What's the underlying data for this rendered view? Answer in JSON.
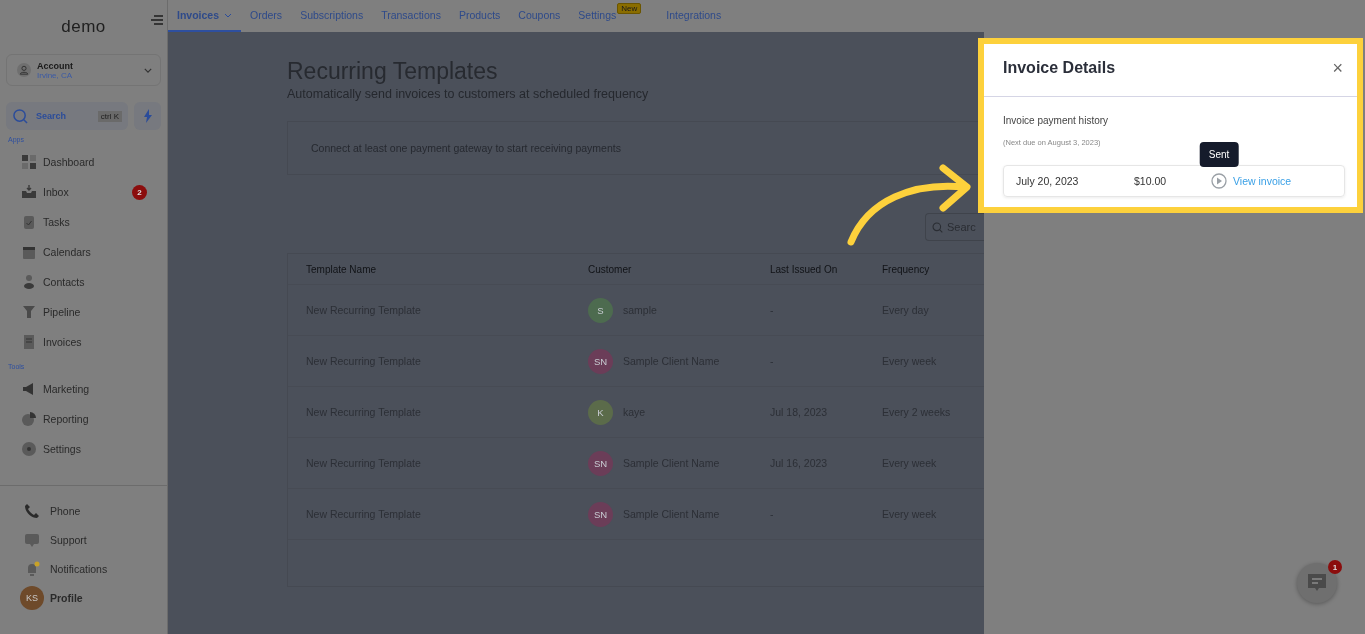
{
  "sidebar": {
    "logo": "demo",
    "account": {
      "name": "Account",
      "location": "Irvine, CA"
    },
    "search": {
      "label": "Search",
      "shortcut": "ctrl K"
    },
    "sections": [
      {
        "title": "Apps",
        "items": [
          {
            "label": "Dashboard"
          },
          {
            "label": "Inbox",
            "badge": "2"
          },
          {
            "label": "Tasks"
          },
          {
            "label": "Calendars"
          },
          {
            "label": "Contacts"
          },
          {
            "label": "Pipeline"
          },
          {
            "label": "Invoices"
          }
        ]
      },
      {
        "title": "Tools",
        "items": [
          {
            "label": "Marketing"
          },
          {
            "label": "Reporting"
          },
          {
            "label": "Settings"
          }
        ]
      }
    ],
    "footer": [
      {
        "label": "Phone"
      },
      {
        "label": "Support"
      },
      {
        "label": "Notifications"
      },
      {
        "label": "Profile",
        "initials": "KS"
      }
    ]
  },
  "tabs": [
    {
      "label": "Invoices",
      "selected": true,
      "dropdown": true
    },
    {
      "label": "Orders",
      "selected": false
    },
    {
      "label": "Subscriptions",
      "selected": false
    },
    {
      "label": "Transactions",
      "selected": false
    },
    {
      "label": "Products",
      "selected": false
    },
    {
      "label": "Coupons",
      "selected": false
    },
    {
      "label": "Settings",
      "selected": false,
      "badge": "New"
    },
    {
      "label": "Integrations",
      "selected": false
    }
  ],
  "page": {
    "title": "Recurring Templates",
    "subtitle": "Automatically send invoices to customers at scheduled frequency",
    "notice": "Connect at least one payment gateway to start receiving payments",
    "search": "Searc"
  },
  "table": {
    "columns": [
      "Template Name",
      "Customer",
      "Last Issued On",
      "Frequency"
    ],
    "rows": [
      {
        "name": "New Recurring Template",
        "initials": "S",
        "color": "#4d6b4f",
        "customer": "sample",
        "last_issued": "-",
        "frequency": "Every day"
      },
      {
        "name": "New Recurring Template",
        "initials": "SN",
        "color": "#6b3d58",
        "customer": "Sample Client Name",
        "last_issued": "-",
        "frequency": "Every week"
      },
      {
        "name": "New Recurring Template",
        "initials": "K",
        "color": "#5b6b4a",
        "customer": "kaye",
        "last_issued": "Jul 18, 2023",
        "frequency": "Every 2 weeks"
      },
      {
        "name": "New Recurring Template",
        "initials": "SN",
        "color": "#6b3d58",
        "customer": "Sample Client Name",
        "last_issued": "Jul 16, 2023",
        "frequency": "Every week"
      },
      {
        "name": "New Recurring Template",
        "initials": "SN",
        "color": "#6b3d58",
        "customer": "Sample Client Name",
        "last_issued": "-",
        "frequency": "Every week"
      }
    ]
  },
  "drawer": {
    "title": "Invoice Details",
    "close": "×",
    "section": "Invoice payment history",
    "next_due": "(Next due on August 3, 2023)",
    "history": [
      {
        "date": "July 20, 2023",
        "amount": "$10.00",
        "tooltip": "Sent",
        "link": "View invoice"
      }
    ]
  },
  "chat": {
    "badge": "1"
  }
}
